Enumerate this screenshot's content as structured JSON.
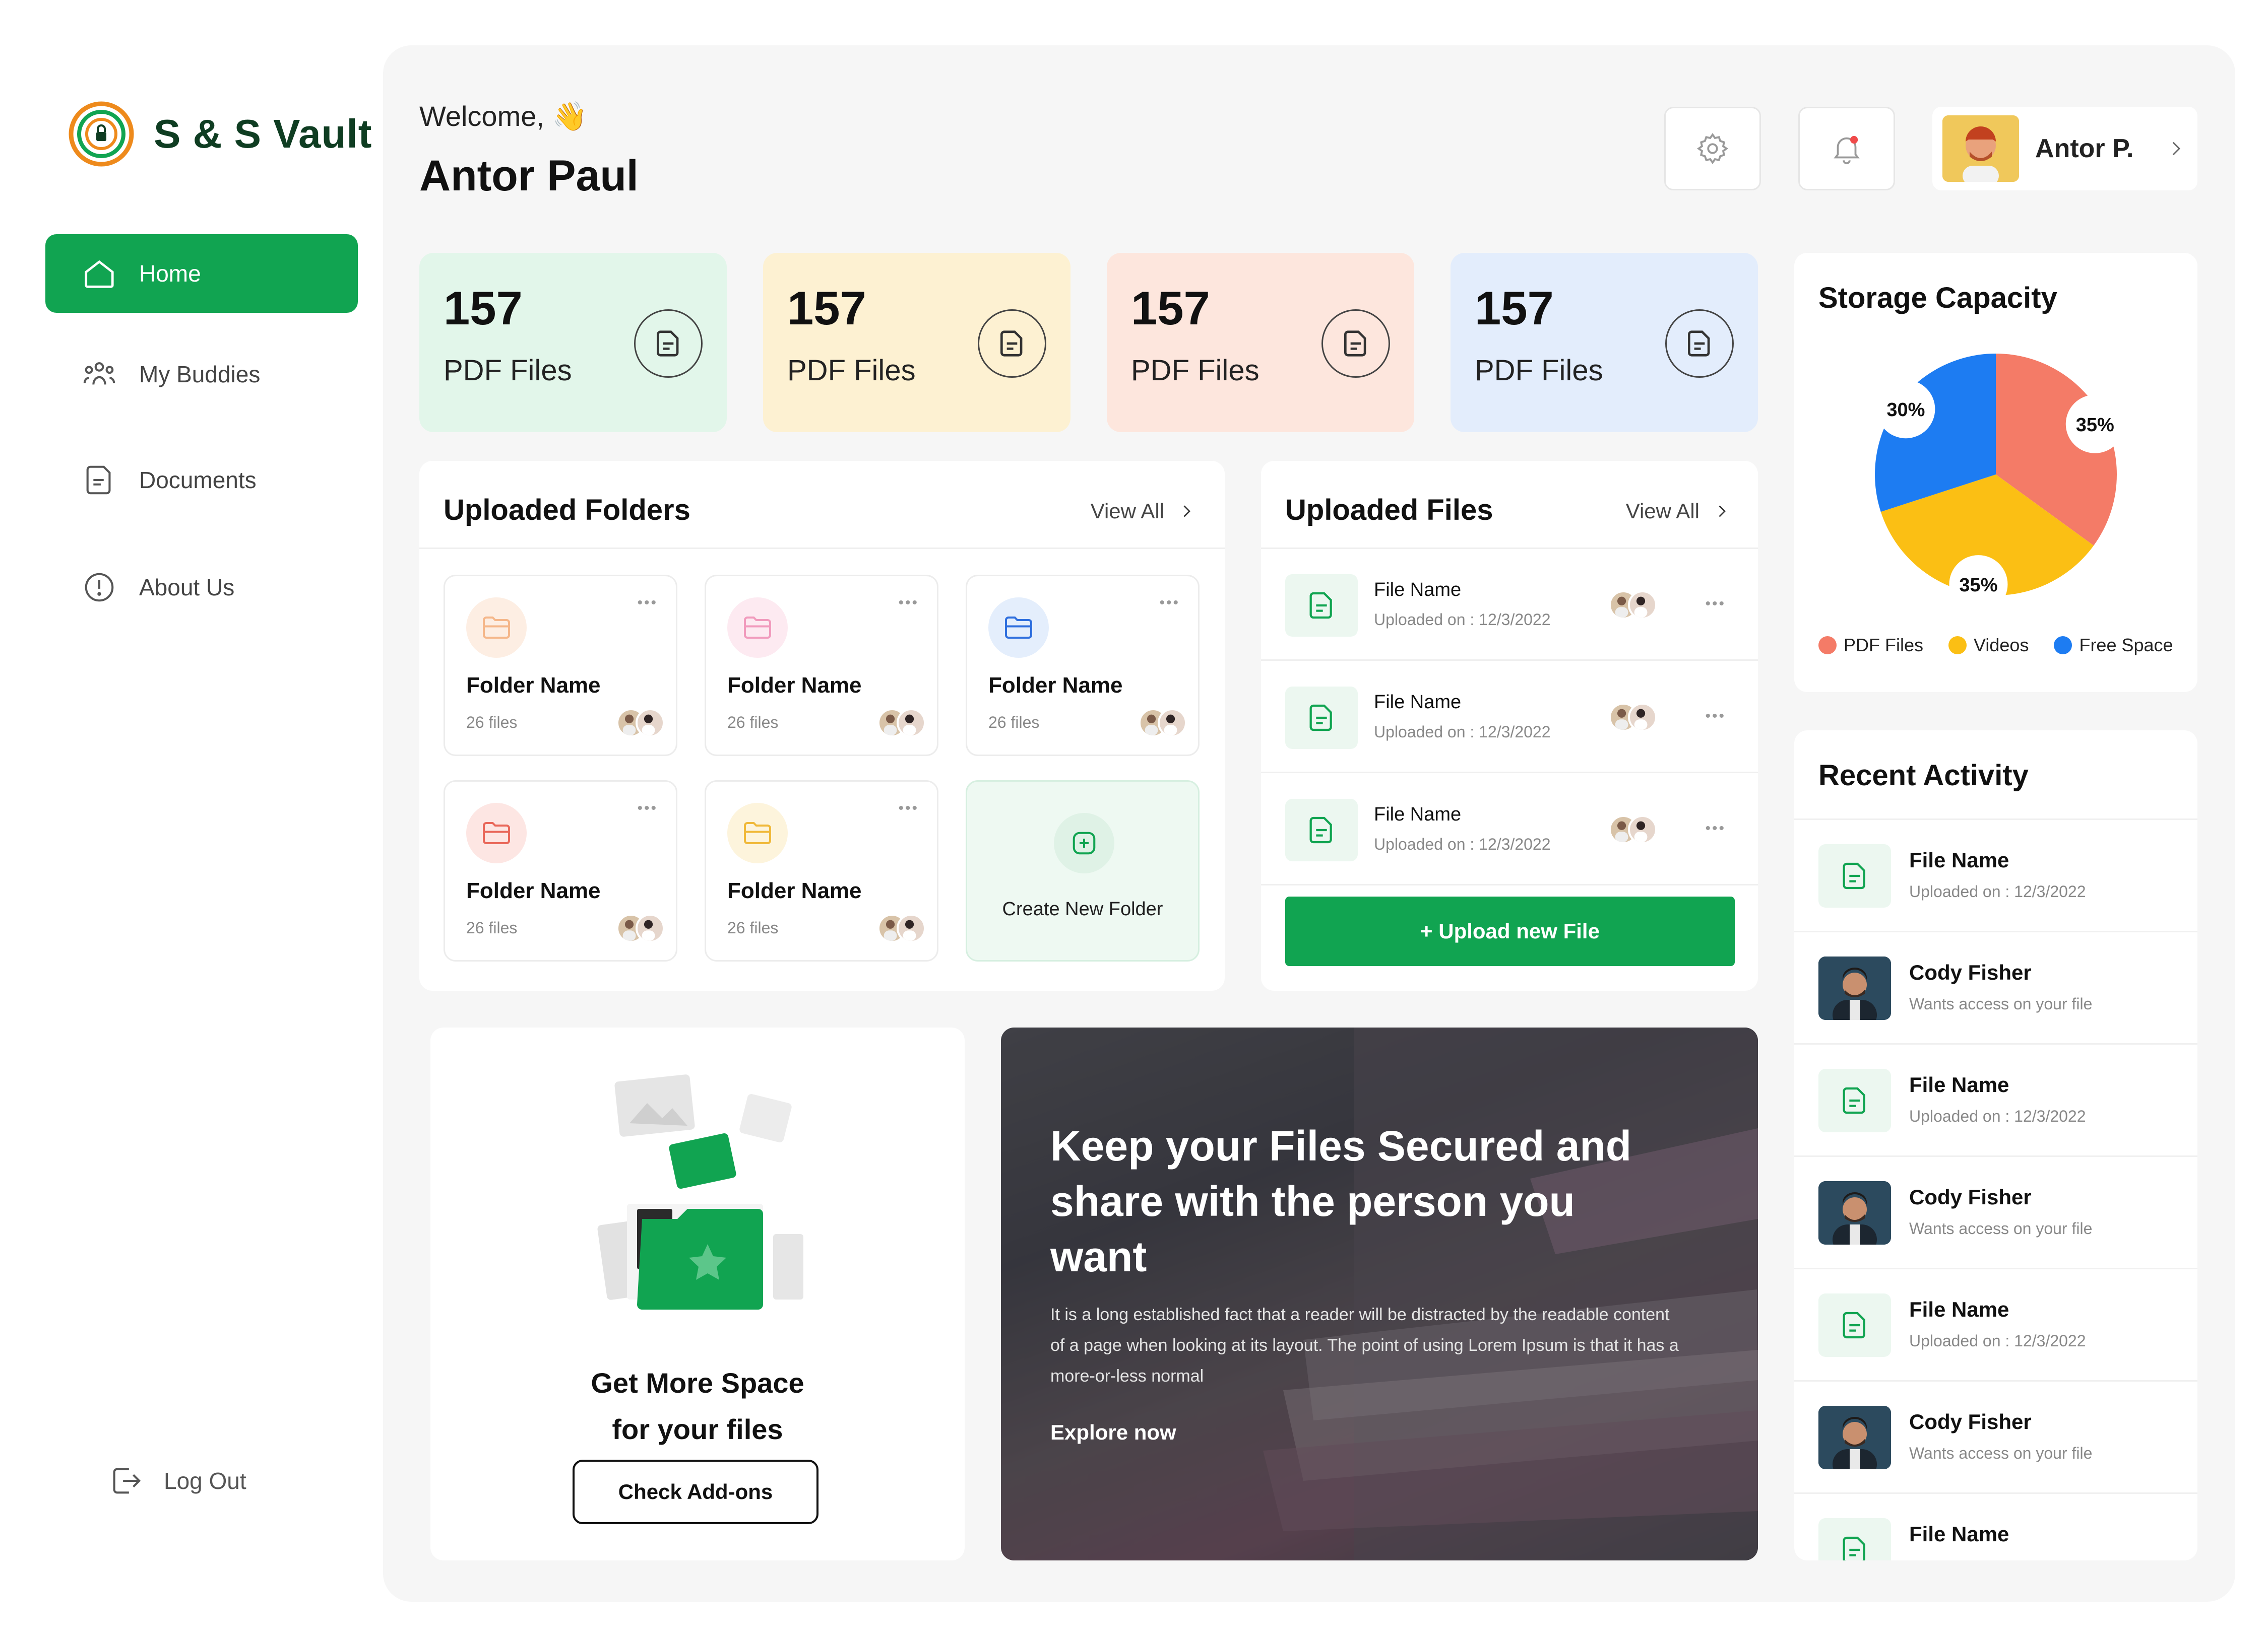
{
  "brand": {
    "name": "S & S Vault"
  },
  "sidebar": {
    "items": [
      {
        "label": "Home"
      },
      {
        "label": "My Buddies"
      },
      {
        "label": "Documents"
      },
      {
        "label": "About Us"
      }
    ],
    "logout_label": "Log Out"
  },
  "header": {
    "welcome": "Welcome, 👋",
    "user_name": "Antor Paul",
    "profile_name": "Antor P."
  },
  "stats": [
    {
      "value": "157",
      "label": "PDF Files",
      "color": "#e2f6ea"
    },
    {
      "value": "157",
      "label": "PDF Files",
      "color": "#fdf1d2"
    },
    {
      "value": "157",
      "label": "PDF Files",
      "color": "#fde6dd"
    },
    {
      "value": "157",
      "label": "PDF Files",
      "color": "#e3edfc"
    }
  ],
  "folders": {
    "title": "Uploaded Folders",
    "view_all": "View All",
    "items": [
      {
        "name": "Folder Name",
        "count": "26 files",
        "tint": "#fdeee3",
        "accent": "#f5b78a"
      },
      {
        "name": "Folder Name",
        "count": "26 files",
        "tint": "#fdeaf1",
        "accent": "#f19bbd"
      },
      {
        "name": "Folder Name",
        "count": "26 files",
        "tint": "#e4eefc",
        "accent": "#2f6fde"
      },
      {
        "name": "Folder Name",
        "count": "26 files",
        "tint": "#fde6e3",
        "accent": "#e9685a"
      },
      {
        "name": "Folder Name",
        "count": "26 files",
        "tint": "#fdf4dc",
        "accent": "#f0b93a"
      }
    ],
    "create_label": "Create New Folder"
  },
  "files": {
    "title": "Uploaded Files",
    "view_all": "View All",
    "items": [
      {
        "name": "File Name",
        "date": "Uploaded on : 12/3/2022"
      },
      {
        "name": "File Name",
        "date": "Uploaded on : 12/3/2022"
      },
      {
        "name": "File Name",
        "date": "Uploaded on : 12/3/2022"
      }
    ],
    "upload_label": "+ Upload new File"
  },
  "storage": {
    "title": "Storage Capacity",
    "slices": [
      {
        "label": "PDF Files",
        "percent": 35,
        "pct_text": "35%",
        "color": "#f47b67"
      },
      {
        "label": "Videos",
        "percent": 35,
        "pct_text": "35%",
        "color": "#fbbf14"
      },
      {
        "label": "Free Space",
        "percent": 30,
        "pct_text": "30%",
        "color": "#1d7cf2"
      }
    ]
  },
  "activity": {
    "title": "Recent Activity",
    "items": [
      {
        "type": "file",
        "title": "File Name",
        "sub": "Uploaded on : 12/3/2022"
      },
      {
        "type": "person",
        "title": "Cody Fisher",
        "sub": "Wants access on your file"
      },
      {
        "type": "file",
        "title": "File Name",
        "sub": "Uploaded on : 12/3/2022"
      },
      {
        "type": "person",
        "title": "Cody Fisher",
        "sub": "Wants access on your file"
      },
      {
        "type": "file",
        "title": "File Name",
        "sub": "Uploaded on : 12/3/2022"
      },
      {
        "type": "person",
        "title": "Cody Fisher",
        "sub": "Wants access on your file"
      },
      {
        "type": "file",
        "title": "File Name",
        "sub": ""
      }
    ]
  },
  "promo": {
    "title_line1": "Get More Space",
    "title_line2": "for your files",
    "button": "Check Add-ons"
  },
  "banner": {
    "heading": "Keep your Files Secured and share with the person you want",
    "body": "It is a long established fact that a reader will be distracted by the readable content of a page when looking at its layout. The point of using Lorem Ipsum is that it has a more-or-less normal",
    "link": "Explore now"
  },
  "colors": {
    "brand_green": "#11a451",
    "logo_orange": "#ee8a1c",
    "logo_dark": "#0f3d22"
  }
}
